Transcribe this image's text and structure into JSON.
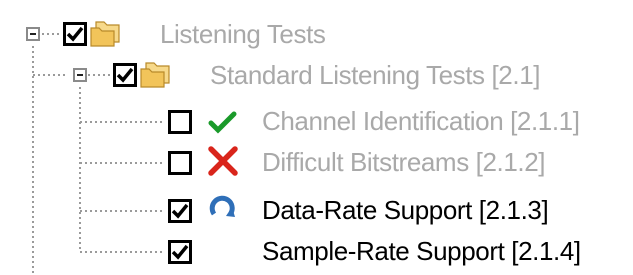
{
  "tree": {
    "root": {
      "label": "Listening Tests",
      "checked": true,
      "expanded": true,
      "icon": "folder-icon",
      "children": [
        {
          "label": "Standard Listening Tests [2.1]",
          "checked": true,
          "expanded": true,
          "icon": "folder-icon",
          "children": [
            {
              "label": "Channel Identification [2.1.1]",
              "checked": false,
              "status": "passed",
              "icon": "green-check-icon"
            },
            {
              "label": "Difficult Bitstreams [2.1.2]",
              "checked": false,
              "status": "failed",
              "icon": "red-x-icon"
            },
            {
              "label": "Data-Rate Support [2.1.3]",
              "checked": true,
              "status": "in-progress",
              "icon": "refresh-arrow-icon"
            },
            {
              "label": "Sample-Rate Support [2.1.4]",
              "checked": true,
              "status": "pending",
              "icon": ""
            }
          ]
        }
      ]
    }
  },
  "colors": {
    "dimmed_text": "#a9a9a9",
    "active_text": "#000000",
    "check_green": "#1a9a2a",
    "x_red": "#d9251b",
    "refresh_blue": "#2f6fb8",
    "folder": "#f2c45a"
  }
}
